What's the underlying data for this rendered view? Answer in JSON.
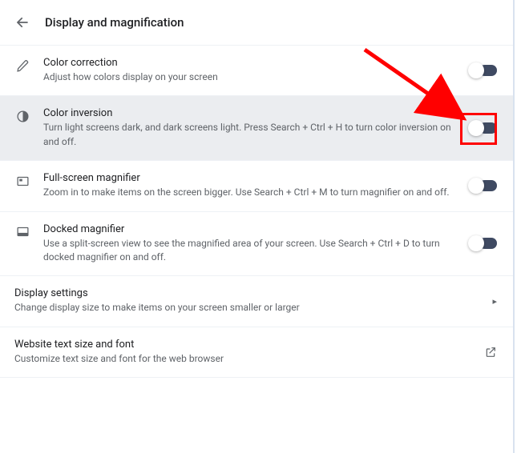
{
  "header": {
    "title": "Display and magnification"
  },
  "rows": {
    "color_correction": {
      "title": "Color correction",
      "desc": "Adjust how colors display on your screen"
    },
    "color_inversion": {
      "title": "Color inversion",
      "desc": "Turn light screens dark, and dark screens light. Press Search + Ctrl + H to turn color inversion on and off."
    },
    "fullscreen_magnifier": {
      "title": "Full-screen magnifier",
      "desc": "Zoom in to make items on the screen bigger. Use Search + Ctrl + M to turn magnifier on and off."
    },
    "docked_magnifier": {
      "title": "Docked magnifier",
      "desc": "Use a split-screen view to see the magnified area of your screen. Use Search + Ctrl + D to turn docked magnifier on and off."
    },
    "display_settings": {
      "title": "Display settings",
      "desc": "Change display size to make items on your screen smaller or larger"
    },
    "website_text": {
      "title": "Website text size and font",
      "desc": "Customize text size and font for the web browser"
    }
  }
}
